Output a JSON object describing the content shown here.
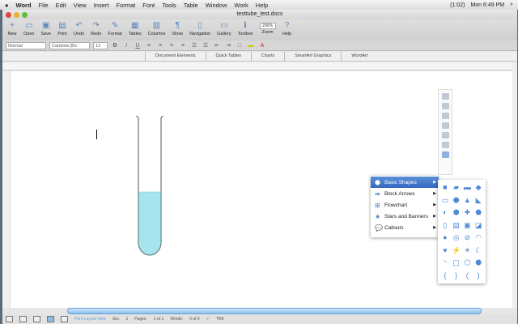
{
  "menubar": {
    "app": "Word",
    "items": [
      "File",
      "Edit",
      "View",
      "Insert",
      "Format",
      "Font",
      "Tools",
      "Table",
      "Window",
      "Work",
      "Help"
    ],
    "battery": "(1:02)",
    "clock": "Mon 6:49 PM"
  },
  "window": {
    "title": "testtube_test.docx"
  },
  "toolbar": {
    "items": [
      {
        "label": "New",
        "icon": "+"
      },
      {
        "label": "Open",
        "icon": "▭"
      },
      {
        "label": "Save",
        "icon": "▣"
      },
      {
        "label": "Print",
        "icon": "▤"
      },
      {
        "label": "Undo",
        "icon": "↶"
      },
      {
        "label": "Redo",
        "icon": "↷"
      },
      {
        "label": "Format",
        "icon": "✎"
      },
      {
        "label": "Tables",
        "icon": "▦"
      },
      {
        "label": "Columns",
        "icon": "▥"
      },
      {
        "label": "Show",
        "icon": "¶"
      },
      {
        "label": "Navigation",
        "icon": "▯"
      },
      {
        "label": "Gallery",
        "icon": "▭"
      },
      {
        "label": "Toolbox",
        "icon": "ℹ"
      },
      {
        "label": "Zoom",
        "icon": "200%"
      },
      {
        "label": "Help",
        "icon": "?"
      }
    ]
  },
  "format": {
    "style": "Normal",
    "font": "Cambria (Bo",
    "size": "12"
  },
  "ribbon": {
    "tabs": [
      "Document Elements",
      "Quick Tables",
      "Charts",
      "SmartArt Graphics",
      "WordArt"
    ]
  },
  "shapes_menu": {
    "items": [
      "Basic Shapes",
      "Block Arrows",
      "Flowchart",
      "Stars and Banners",
      "Callouts"
    ],
    "active": "Basic Shapes"
  },
  "shape_glyphs": [
    "■",
    "▰",
    "▬",
    "◆",
    "▭",
    "⬣",
    "▲",
    "◣",
    "◐",
    "⬢",
    "✚",
    "⬟",
    "▯",
    "▤",
    "▣",
    "◪",
    "●",
    "◎",
    "⊘",
    "◠",
    "♥",
    "⚡",
    "☀",
    "☾",
    "◝",
    "▢",
    "⬡",
    "⬣",
    "{",
    "}",
    "(",
    ")"
  ],
  "status": {
    "view": "Print Layout View",
    "sec_label": "Sec",
    "sec": "1",
    "pages_label": "Pages:",
    "pages": "1 of 1",
    "words_label": "Words:",
    "words": "0 of 0",
    "trk": "TRK"
  },
  "colors": {
    "liquid": "#a8e4ee",
    "accent": "#3568c0"
  }
}
